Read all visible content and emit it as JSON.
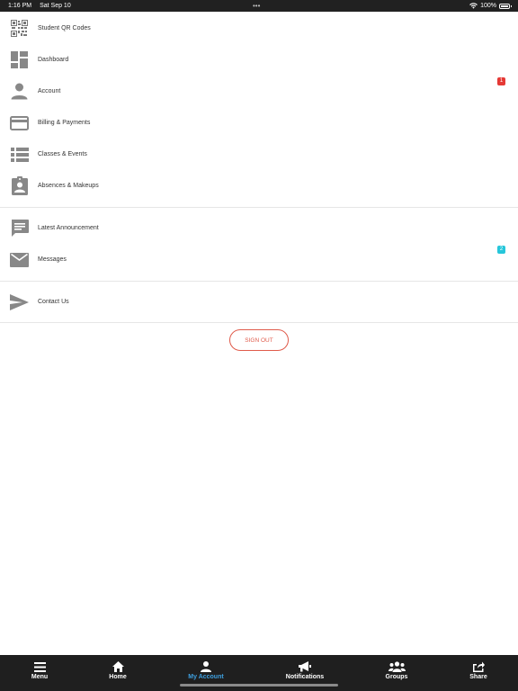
{
  "status_bar": {
    "time": "1:16 PM",
    "date": "Sat Sep 10",
    "battery": "100%"
  },
  "menu": {
    "groups": [
      {
        "items": [
          {
            "label": "Student QR Codes",
            "icon": "qr-code-icon"
          },
          {
            "label": "Dashboard",
            "icon": "dashboard-icon"
          },
          {
            "label": "Account",
            "icon": "person-icon",
            "badge": "1",
            "badge_color": "#e53935"
          },
          {
            "label": "Billing & Payments",
            "icon": "credit-card-icon"
          },
          {
            "label": "Classes & Events",
            "icon": "list-icon"
          },
          {
            "label": "Absences & Makeups",
            "icon": "assignment-ind-icon"
          }
        ]
      },
      {
        "items": [
          {
            "label": "Latest Announcement",
            "icon": "announcement-icon"
          },
          {
            "label": "Messages",
            "icon": "mail-icon",
            "badge": "2",
            "badge_color": "#26c6da"
          }
        ]
      },
      {
        "items": [
          {
            "label": "Contact Us",
            "icon": "send-icon"
          }
        ]
      }
    ]
  },
  "signout": {
    "label": "SIGN OUT",
    "color": "#e05b4b"
  },
  "tab_bar": {
    "active": "My Account",
    "active_color": "#3ea0e0",
    "tabs": [
      {
        "label": "Menu",
        "icon": "hamburger-menu-icon"
      },
      {
        "label": "Home",
        "icon": "home-icon"
      },
      {
        "label": "My Account",
        "icon": "person-icon"
      },
      {
        "label": "Notifications",
        "icon": "megaphone-icon"
      },
      {
        "label": "Groups",
        "icon": "groups-icon"
      },
      {
        "label": "Share",
        "icon": "share-icon"
      }
    ]
  }
}
